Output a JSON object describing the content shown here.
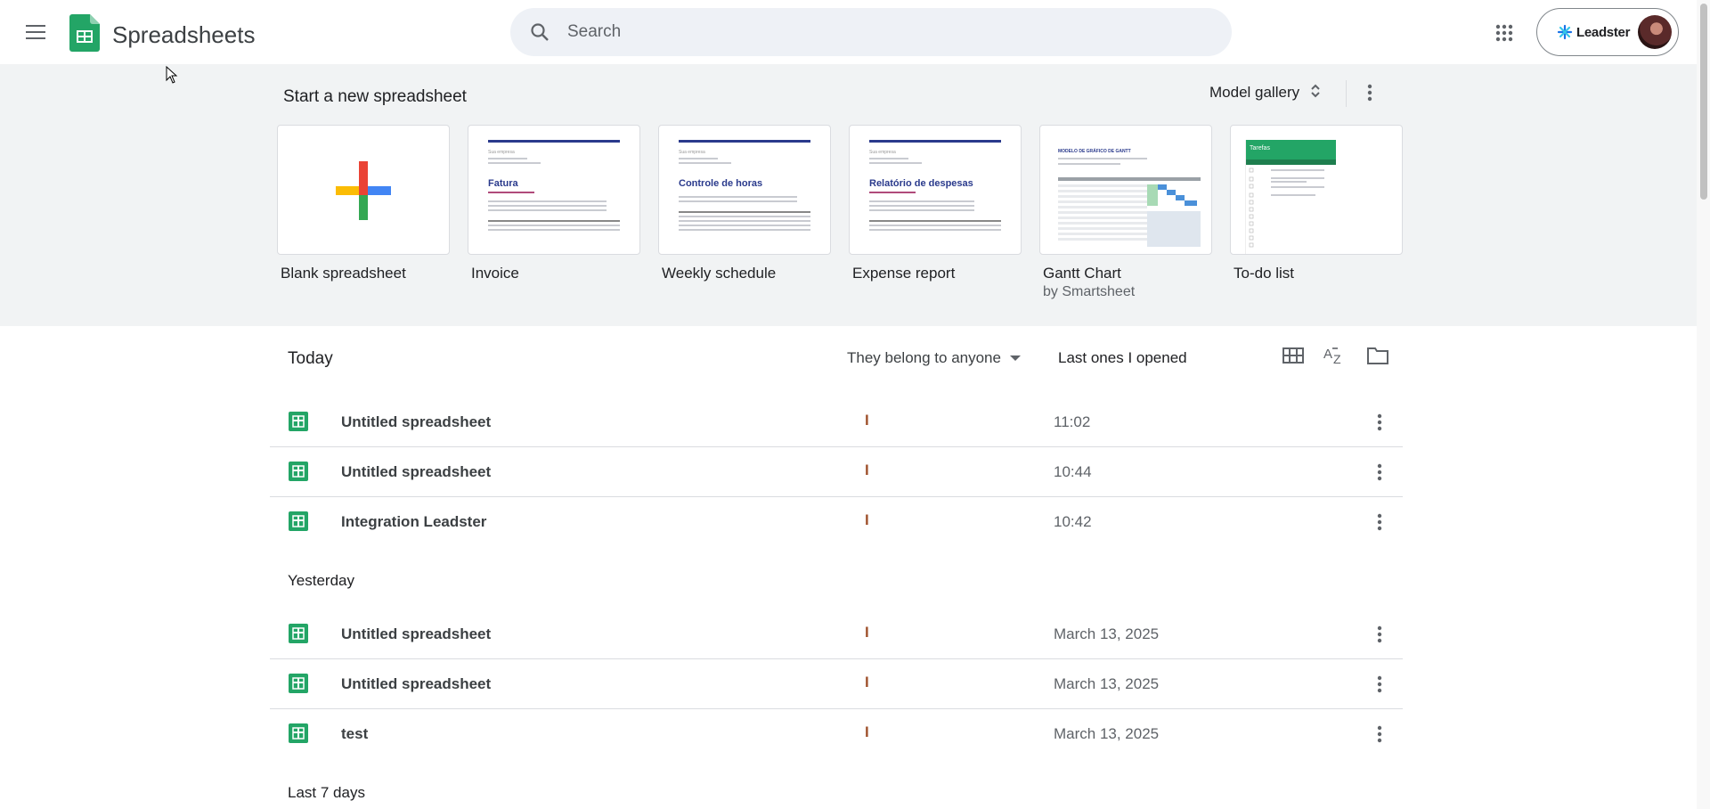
{
  "header": {
    "app_title": "Spreadsheets",
    "search_placeholder": "Search",
    "account_brand": "Leadster"
  },
  "templates": {
    "title": "Start a new spreadsheet",
    "gallery_label": "Model gallery",
    "items": [
      {
        "label": "Blank spreadsheet",
        "sub": ""
      },
      {
        "label": "Invoice",
        "sub": "",
        "thumb_title": "Fatura"
      },
      {
        "label": "Weekly schedule",
        "sub": "",
        "thumb_title": "Controle de horas"
      },
      {
        "label": "Expense report",
        "sub": "",
        "thumb_title": "Relatório de despesas"
      },
      {
        "label": "Gantt Chart",
        "sub": "by Smartsheet",
        "thumb_title": "MODELO DE GRÁFICO DE GANTT"
      },
      {
        "label": "To-do list",
        "sub": "",
        "thumb_title": "Tarefas"
      }
    ],
    "thumb_company": "Sua empresa"
  },
  "files": {
    "section_label": "Today",
    "owner_filter": "They belong to anyone",
    "sort_label": "Last ones I opened",
    "groups": [
      {
        "label": "Today",
        "rows": [
          {
            "name": "Untitled spreadsheet",
            "owner": "I",
            "date": "11:02"
          },
          {
            "name": "Untitled spreadsheet",
            "owner": "I",
            "date": "10:44"
          },
          {
            "name": "Integration Leadster",
            "owner": "I",
            "date": "10:42"
          }
        ]
      },
      {
        "label": "Yesterday",
        "rows": [
          {
            "name": "Untitled spreadsheet",
            "owner": "I",
            "date": "March 13, 2025"
          },
          {
            "name": "Untitled spreadsheet",
            "owner": "I",
            "date": "March 13, 2025"
          },
          {
            "name": "test",
            "owner": "I",
            "date": "March 13, 2025"
          }
        ]
      },
      {
        "label": "Last 7 days",
        "rows": []
      }
    ]
  },
  "colors": {
    "sheets_green": "#23a566",
    "accent_blue": "#4285f4",
    "header_bg": "#ffffff",
    "templates_bg": "#f1f3f4"
  },
  "icons": [
    "menu-icon",
    "sheets-logo-icon",
    "search-icon",
    "apps-grid-icon",
    "unfold-icon",
    "more-vert-icon",
    "grid-view-icon",
    "sort-az-icon",
    "folder-icon",
    "spreadsheet-file-icon"
  ]
}
